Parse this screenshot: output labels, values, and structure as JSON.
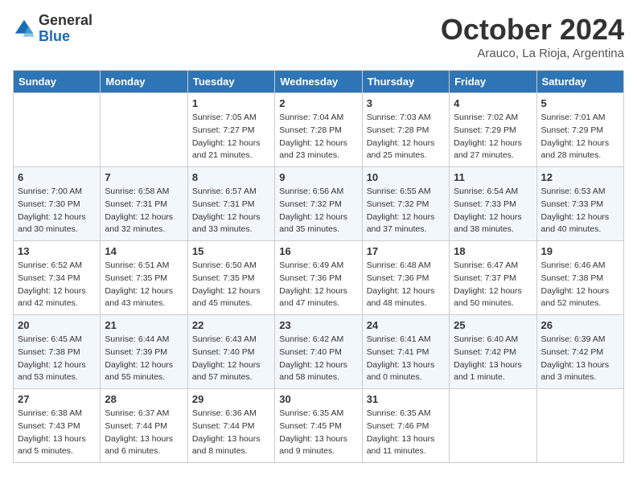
{
  "header": {
    "logo": {
      "general": "General",
      "blue": "Blue"
    },
    "title": "October 2024",
    "subtitle": "Arauco, La Rioja, Argentina"
  },
  "days_of_week": [
    "Sunday",
    "Monday",
    "Tuesday",
    "Wednesday",
    "Thursday",
    "Friday",
    "Saturday"
  ],
  "weeks": [
    [
      null,
      null,
      {
        "day": "1",
        "sunrise": "7:05 AM",
        "sunset": "7:27 PM",
        "daylight": "12 hours and 21 minutes."
      },
      {
        "day": "2",
        "sunrise": "7:04 AM",
        "sunset": "7:28 PM",
        "daylight": "12 hours and 23 minutes."
      },
      {
        "day": "3",
        "sunrise": "7:03 AM",
        "sunset": "7:28 PM",
        "daylight": "12 hours and 25 minutes."
      },
      {
        "day": "4",
        "sunrise": "7:02 AM",
        "sunset": "7:29 PM",
        "daylight": "12 hours and 27 minutes."
      },
      {
        "day": "5",
        "sunrise": "7:01 AM",
        "sunset": "7:29 PM",
        "daylight": "12 hours and 28 minutes."
      }
    ],
    [
      {
        "day": "6",
        "sunrise": "7:00 AM",
        "sunset": "7:30 PM",
        "daylight": "12 hours and 30 minutes."
      },
      {
        "day": "7",
        "sunrise": "6:58 AM",
        "sunset": "7:31 PM",
        "daylight": "12 hours and 32 minutes."
      },
      {
        "day": "8",
        "sunrise": "6:57 AM",
        "sunset": "7:31 PM",
        "daylight": "12 hours and 33 minutes."
      },
      {
        "day": "9",
        "sunrise": "6:56 AM",
        "sunset": "7:32 PM",
        "daylight": "12 hours and 35 minutes."
      },
      {
        "day": "10",
        "sunrise": "6:55 AM",
        "sunset": "7:32 PM",
        "daylight": "12 hours and 37 minutes."
      },
      {
        "day": "11",
        "sunrise": "6:54 AM",
        "sunset": "7:33 PM",
        "daylight": "12 hours and 38 minutes."
      },
      {
        "day": "12",
        "sunrise": "6:53 AM",
        "sunset": "7:33 PM",
        "daylight": "12 hours and 40 minutes."
      }
    ],
    [
      {
        "day": "13",
        "sunrise": "6:52 AM",
        "sunset": "7:34 PM",
        "daylight": "12 hours and 42 minutes."
      },
      {
        "day": "14",
        "sunrise": "6:51 AM",
        "sunset": "7:35 PM",
        "daylight": "12 hours and 43 minutes."
      },
      {
        "day": "15",
        "sunrise": "6:50 AM",
        "sunset": "7:35 PM",
        "daylight": "12 hours and 45 minutes."
      },
      {
        "day": "16",
        "sunrise": "6:49 AM",
        "sunset": "7:36 PM",
        "daylight": "12 hours and 47 minutes."
      },
      {
        "day": "17",
        "sunrise": "6:48 AM",
        "sunset": "7:36 PM",
        "daylight": "12 hours and 48 minutes."
      },
      {
        "day": "18",
        "sunrise": "6:47 AM",
        "sunset": "7:37 PM",
        "daylight": "12 hours and 50 minutes."
      },
      {
        "day": "19",
        "sunrise": "6:46 AM",
        "sunset": "7:38 PM",
        "daylight": "12 hours and 52 minutes."
      }
    ],
    [
      {
        "day": "20",
        "sunrise": "6:45 AM",
        "sunset": "7:38 PM",
        "daylight": "12 hours and 53 minutes."
      },
      {
        "day": "21",
        "sunrise": "6:44 AM",
        "sunset": "7:39 PM",
        "daylight": "12 hours and 55 minutes."
      },
      {
        "day": "22",
        "sunrise": "6:43 AM",
        "sunset": "7:40 PM",
        "daylight": "12 hours and 57 minutes."
      },
      {
        "day": "23",
        "sunrise": "6:42 AM",
        "sunset": "7:40 PM",
        "daylight": "12 hours and 58 minutes."
      },
      {
        "day": "24",
        "sunrise": "6:41 AM",
        "sunset": "7:41 PM",
        "daylight": "13 hours and 0 minutes."
      },
      {
        "day": "25",
        "sunrise": "6:40 AM",
        "sunset": "7:42 PM",
        "daylight": "13 hours and 1 minute."
      },
      {
        "day": "26",
        "sunrise": "6:39 AM",
        "sunset": "7:42 PM",
        "daylight": "13 hours and 3 minutes."
      }
    ],
    [
      {
        "day": "27",
        "sunrise": "6:38 AM",
        "sunset": "7:43 PM",
        "daylight": "13 hours and 5 minutes."
      },
      {
        "day": "28",
        "sunrise": "6:37 AM",
        "sunset": "7:44 PM",
        "daylight": "13 hours and 6 minutes."
      },
      {
        "day": "29",
        "sunrise": "6:36 AM",
        "sunset": "7:44 PM",
        "daylight": "13 hours and 8 minutes."
      },
      {
        "day": "30",
        "sunrise": "6:35 AM",
        "sunset": "7:45 PM",
        "daylight": "13 hours and 9 minutes."
      },
      {
        "day": "31",
        "sunrise": "6:35 AM",
        "sunset": "7:46 PM",
        "daylight": "13 hours and 11 minutes."
      },
      null,
      null
    ]
  ]
}
